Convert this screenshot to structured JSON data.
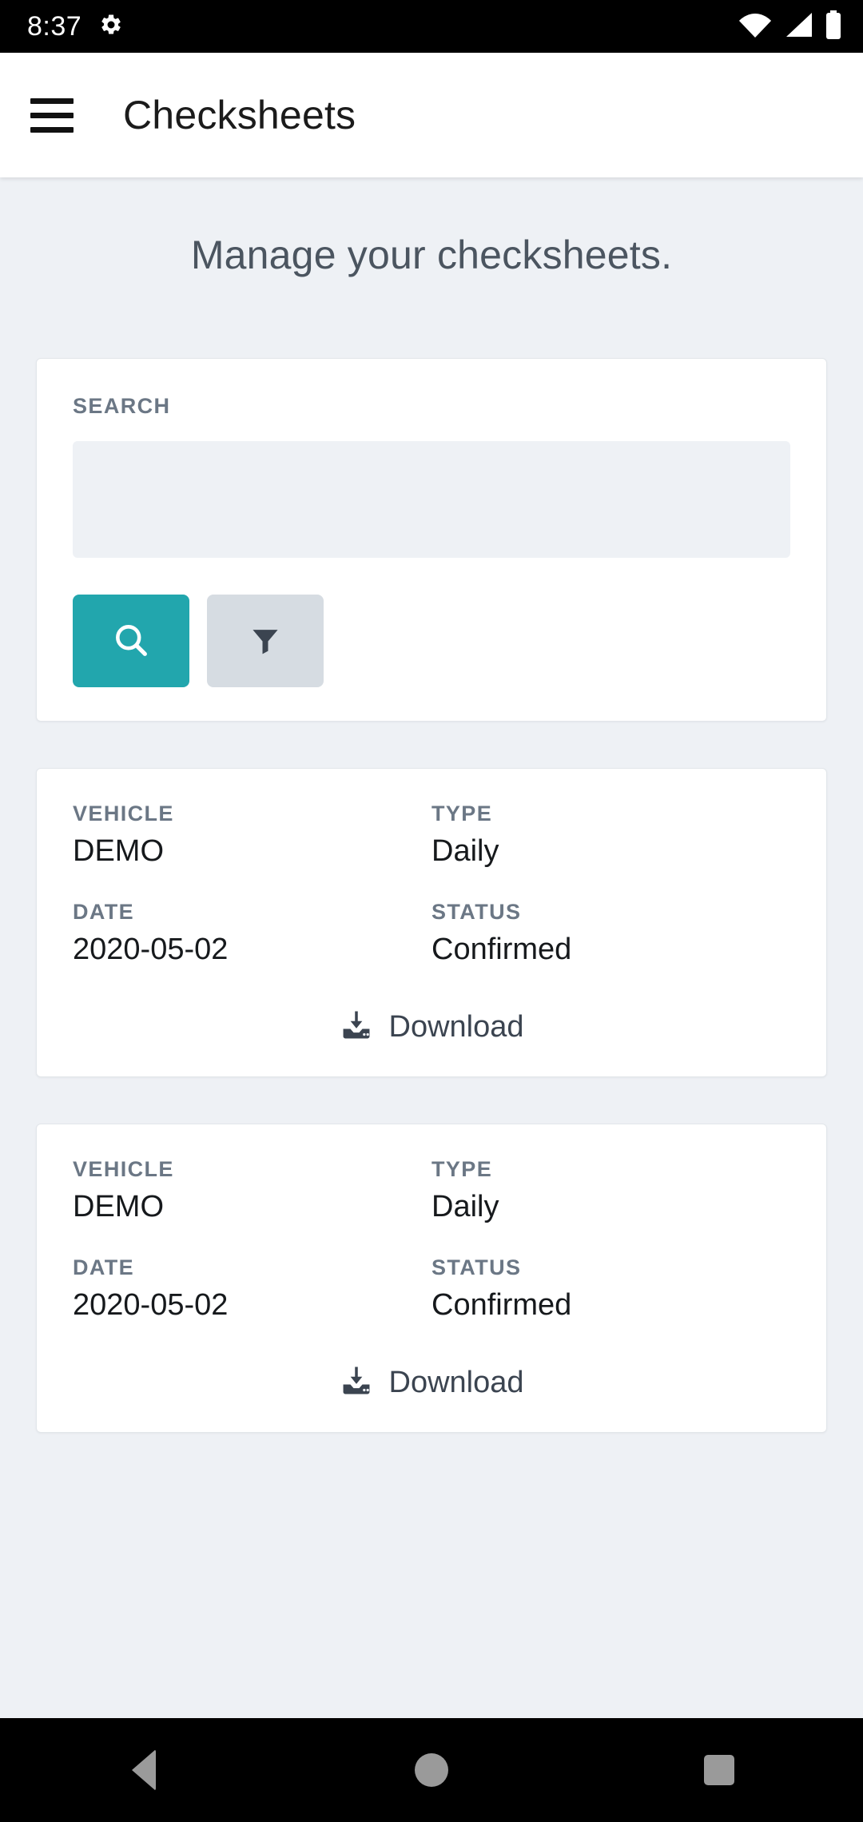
{
  "status_bar": {
    "clock": "8:37",
    "icons": {
      "settings": "gear-icon",
      "wifi": "wifi-icon",
      "signal": "cellular-signal-icon",
      "battery": "battery-icon"
    }
  },
  "app_bar": {
    "menu_icon": "hamburger-menu-icon",
    "title": "Checksheets"
  },
  "main": {
    "heading": "Manage your checksheets.",
    "search": {
      "label": "SEARCH",
      "value": "",
      "placeholder": "",
      "search_button_icon": "search-icon",
      "filter_button_icon": "filter-funnel-icon"
    },
    "records": [
      {
        "vehicle_label": "VEHICLE",
        "vehicle_value": "DEMO",
        "type_label": "TYPE",
        "type_value": "Daily",
        "date_label": "DATE",
        "date_value": "2020-05-02",
        "status_label": "STATUS",
        "status_value": "Confirmed",
        "download_label": "Download",
        "download_icon": "download-icon"
      },
      {
        "vehicle_label": "VEHICLE",
        "vehicle_value": "DEMO",
        "type_label": "TYPE",
        "type_value": "Daily",
        "date_label": "DATE",
        "date_value": "2020-05-02",
        "status_label": "STATUS",
        "status_value": "Confirmed",
        "download_label": "Download",
        "download_icon": "download-icon"
      }
    ]
  },
  "nav_bar": {
    "back": "back-nav-icon",
    "home": "home-nav-icon",
    "recents": "recents-nav-icon"
  },
  "colors": {
    "accent_teal": "#22a6ad",
    "filter_gray": "#d6dce2",
    "page_background": "#eef1f5",
    "card_background": "#ffffff",
    "label_gray": "#6b7785",
    "value_dark": "#16191c",
    "heading_slate": "#4b5560",
    "nav_icon_gray": "#9a9a9a"
  }
}
